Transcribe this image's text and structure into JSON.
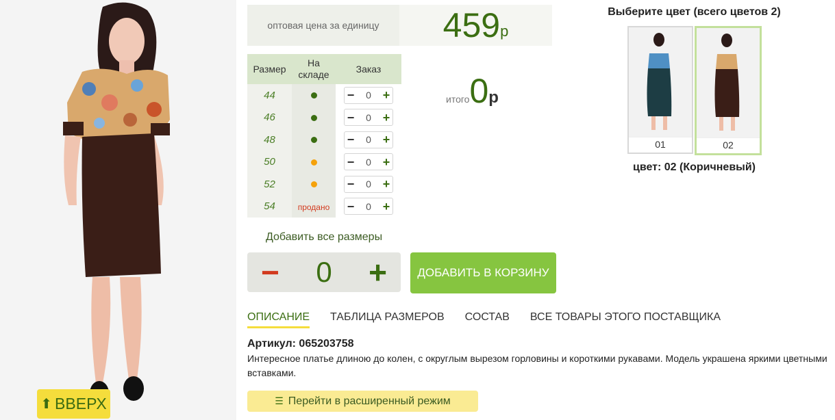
{
  "price": {
    "label": "оптовая цена за единицу",
    "value": "459",
    "currency": "р"
  },
  "sizes_table": {
    "headers": {
      "size": "Размер",
      "stock_line1": "На",
      "stock_line2": "складе",
      "order": "Заказ"
    },
    "rows": [
      {
        "size": "44",
        "stock": "green",
        "qty": "0"
      },
      {
        "size": "46",
        "stock": "green",
        "qty": "0"
      },
      {
        "size": "48",
        "stock": "green",
        "qty": "0"
      },
      {
        "size": "50",
        "stock": "orange",
        "qty": "0"
      },
      {
        "size": "52",
        "stock": "orange",
        "qty": "0"
      },
      {
        "size": "54",
        "stock": "sold",
        "stock_text": "продано",
        "qty": "0"
      }
    ],
    "minus": "−",
    "plus": "+"
  },
  "total": {
    "label": "итого",
    "value": "0",
    "currency": "р"
  },
  "colors": {
    "title": "Выберите цвет (всего цветов 2)",
    "items": [
      {
        "label": "01",
        "selected": false
      },
      {
        "label": "02",
        "selected": true
      }
    ],
    "selected_text": "цвет: 02 (Коричневый)"
  },
  "add_all": {
    "label": "Добавить все размеры",
    "qty": "0",
    "minus": "−",
    "plus": "+"
  },
  "cart_button": "ДОБАВИТЬ В КОРЗИНУ",
  "tabs": [
    {
      "label": "ОПИСАНИЕ",
      "active": true
    },
    {
      "label": "ТАБЛИЦА РАЗМЕРОВ",
      "active": false
    },
    {
      "label": "СОСТАВ",
      "active": false
    },
    {
      "label": "ВСЕ ТОВАРЫ ЭТОГО ПОСТАВЩИКА",
      "active": false
    }
  ],
  "description": {
    "article": "Артикул: 065203758",
    "text": "Интересное платье длиною до колен, с округлым вырезом горловины и короткими рукавами. Модель украшена яркими цветными вставками."
  },
  "advanced_button": {
    "label": "Перейти в расширенный режим",
    "icon": "list-icon"
  },
  "up_button": {
    "label": "ВВЕРХ",
    "icon": "arrow-up-icon"
  },
  "colors_palette": {
    "accent_green": "#3b6e12",
    "button_green": "#86c540",
    "yellow": "#f5dd3c",
    "red": "#d23a1e",
    "orange": "#f5a20b"
  }
}
